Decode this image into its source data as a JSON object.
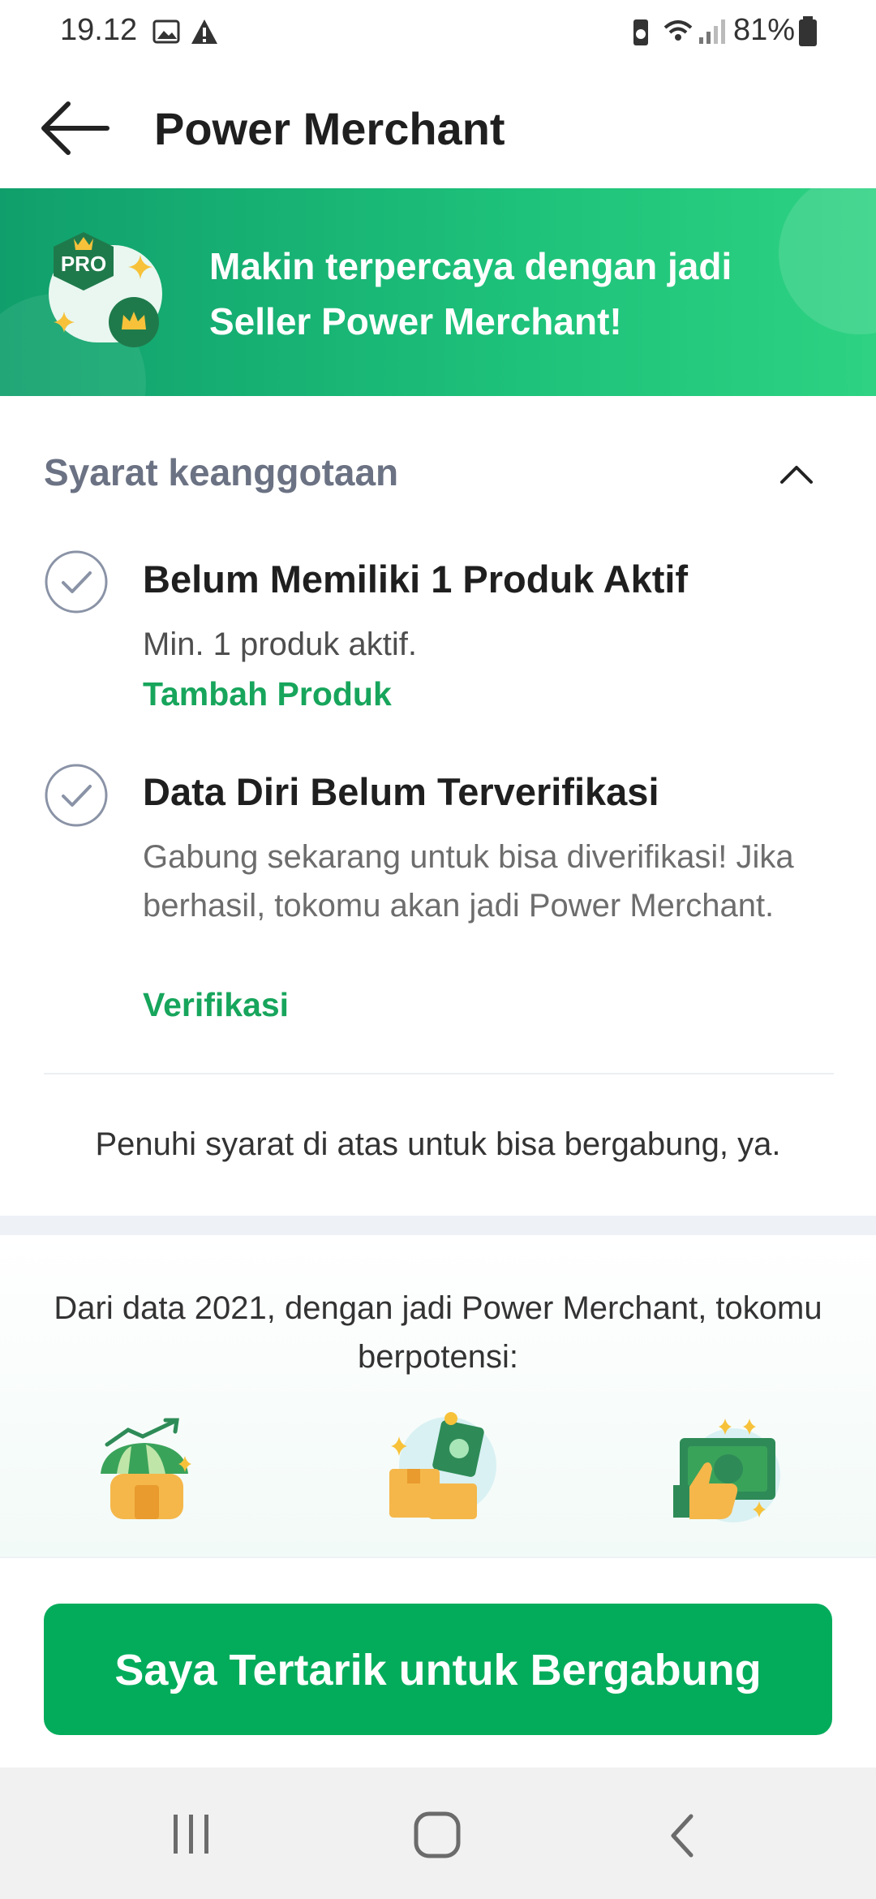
{
  "status_bar": {
    "time": "19.12",
    "battery": "81%"
  },
  "app_bar": {
    "title": "Power Merchant",
    "back_icon": "arrow-left-icon"
  },
  "banner": {
    "text": "Makin terpercaya dengan jadi Seller Power Merchant!",
    "badge_label": "PRO"
  },
  "membership": {
    "title": "Syarat keanggotaan",
    "requirements": [
      {
        "title": "Belum Memiliki 1 Produk Aktif",
        "description": "Min. 1 produk aktif.",
        "action": "Tambah Produk"
      },
      {
        "title": "Data Diri Belum Terverifikasi",
        "description": "Gabung sekarang untuk bisa diverifikasi! Jika berhasil, tokomu akan jadi Power Merchant.",
        "action": "Verifikasi"
      }
    ],
    "note": "Penuhi syarat di atas untuk bisa bergabung, ya."
  },
  "potential": {
    "text": "Dari data 2021, dengan jadi Power Merchant, tokomu berpotensi:",
    "icons": [
      "store-growth-icon",
      "money-boxes-icon",
      "money-thumbs-up-icon"
    ]
  },
  "cta": {
    "label": "Saya Tertarik untuk Bergabung"
  },
  "colors": {
    "primary": "#03ac5b",
    "banner": "#1ec27a",
    "link": "#17a55c"
  }
}
